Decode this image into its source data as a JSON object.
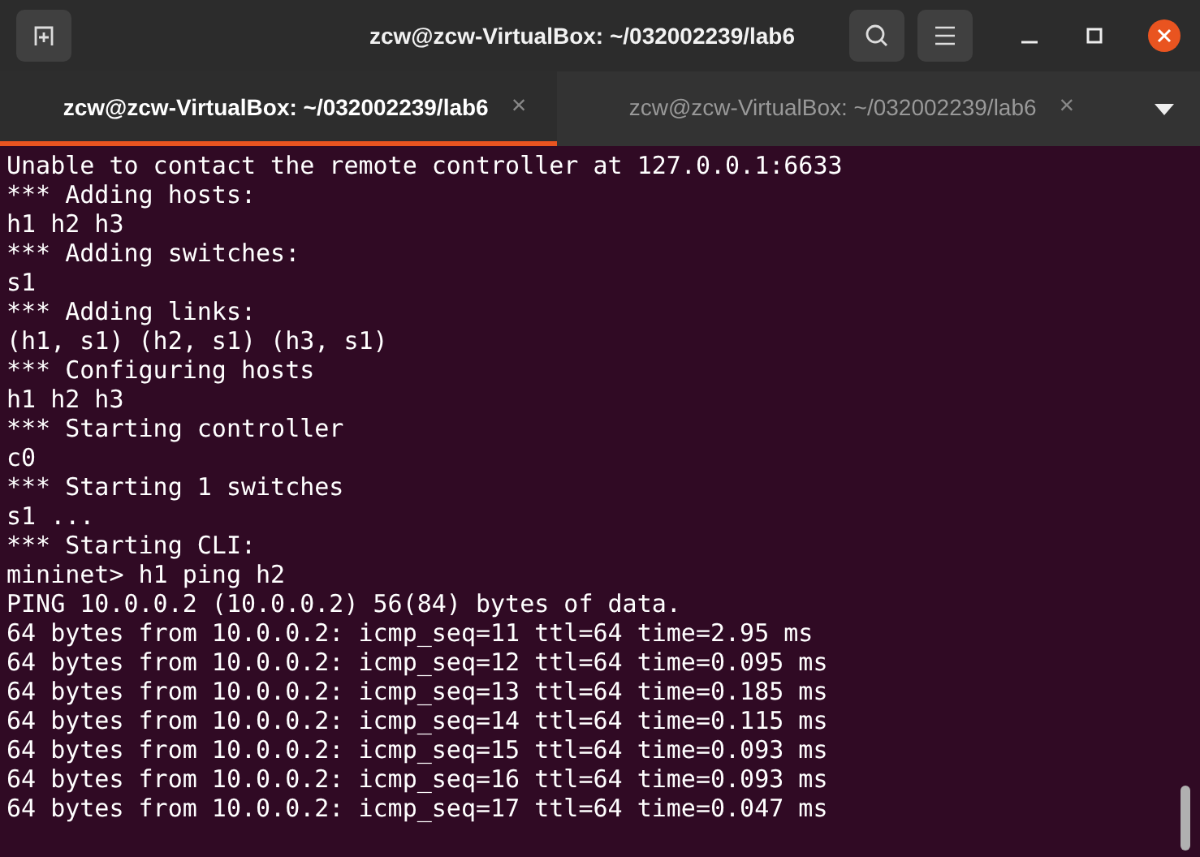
{
  "window": {
    "title": "zcw@zcw-VirtualBox: ~/032002239/lab6"
  },
  "tabs": [
    {
      "label": "zcw@zcw-VirtualBox: ~/032002239/lab6",
      "close": "×",
      "selected": true
    },
    {
      "label": "zcw@zcw-VirtualBox: ~/032002239/lab6",
      "close": "×",
      "selected": false
    }
  ],
  "terminal": {
    "lines": [
      "Unable to contact the remote controller at 127.0.0.1:6633",
      "*** Adding hosts:",
      "h1 h2 h3",
      "*** Adding switches:",
      "s1",
      "*** Adding links:",
      "(h1, s1) (h2, s1) (h3, s1)",
      "*** Configuring hosts",
      "h1 h2 h3",
      "*** Starting controller",
      "c0",
      "*** Starting 1 switches",
      "s1 ...",
      "*** Starting CLI:",
      "mininet> h1 ping h2",
      "PING 10.0.0.2 (10.0.0.2) 56(84) bytes of data.",
      "64 bytes from 10.0.0.2: icmp_seq=11 ttl=64 time=2.95 ms",
      "64 bytes from 10.0.0.2: icmp_seq=12 ttl=64 time=0.095 ms",
      "64 bytes from 10.0.0.2: icmp_seq=13 ttl=64 time=0.185 ms",
      "64 bytes from 10.0.0.2: icmp_seq=14 ttl=64 time=0.115 ms",
      "64 bytes from 10.0.0.2: icmp_seq=15 ttl=64 time=0.093 ms",
      "64 bytes from 10.0.0.2: icmp_seq=16 ttl=64 time=0.093 ms",
      "64 bytes from 10.0.0.2: icmp_seq=17 ttl=64 time=0.047 ms"
    ]
  }
}
